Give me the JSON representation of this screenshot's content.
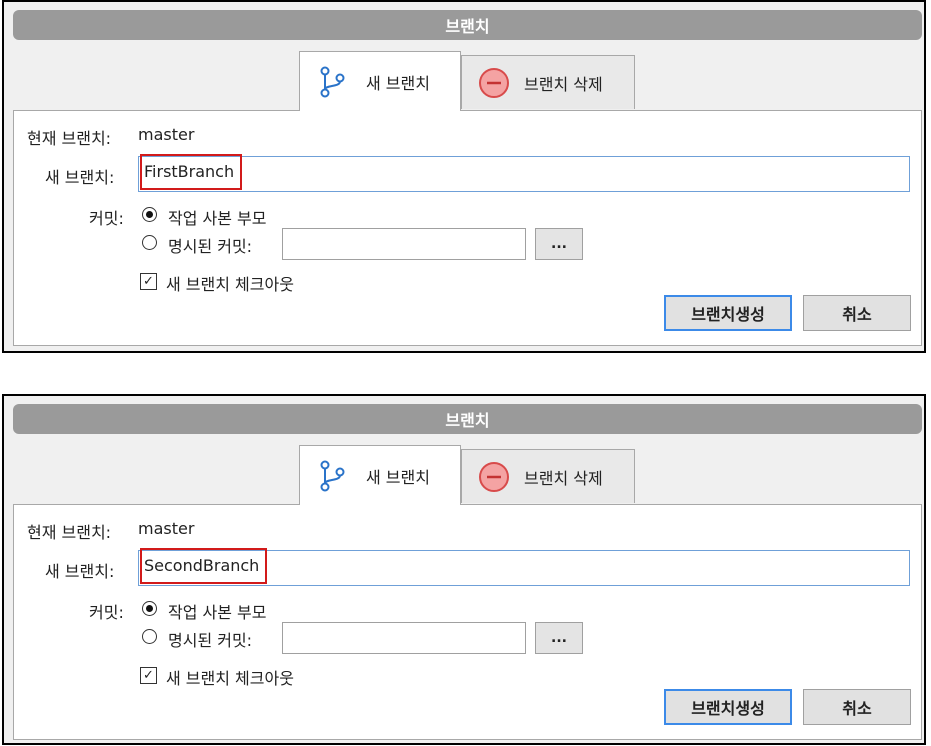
{
  "dialogs": [
    {
      "title": "브랜치",
      "tabs": [
        {
          "label": "새 브랜치",
          "icon": "branch-icon"
        },
        {
          "label": "브랜치 삭제",
          "icon": "minus-circle-icon"
        }
      ],
      "current_branch_label": "현재 브랜치:",
      "current_branch_value": "master",
      "new_branch_label": "새 브랜치:",
      "new_branch_value": "FirstBranch",
      "commit_label": "커밋:",
      "commit_options": [
        {
          "label": "작업 사본 부모",
          "checked": true
        },
        {
          "label": "명시된 커밋:",
          "checked": false
        }
      ],
      "commit_input_value": "",
      "browse_label": "...",
      "checkout_label": "새 브랜치 체크아웃",
      "checkout_checked": true,
      "create_button": "브랜치생성",
      "cancel_button": "취소"
    },
    {
      "title": "브랜치",
      "tabs": [
        {
          "label": "새 브랜치",
          "icon": "branch-icon"
        },
        {
          "label": "브랜치 삭제",
          "icon": "minus-circle-icon"
        }
      ],
      "current_branch_label": "현재 브랜치:",
      "current_branch_value": "master",
      "new_branch_label": "새 브랜치:",
      "new_branch_value": "SecondBranch",
      "commit_label": "커밋:",
      "commit_options": [
        {
          "label": "작업 사본 부모",
          "checked": true
        },
        {
          "label": "명시된 커밋:",
          "checked": false
        }
      ],
      "commit_input_value": "",
      "browse_label": "...",
      "checkout_label": "새 브랜치 체크아웃",
      "checkout_checked": true,
      "create_button": "브랜치생성",
      "cancel_button": "취소"
    }
  ],
  "colors": {
    "title_bar": "#9a9a9a",
    "highlight_border": "#d21a1a",
    "focus_border": "#3c8ae8",
    "branch_icon": "#2a73c9",
    "delete_icon_fill": "#f4a3a3",
    "delete_icon_stroke": "#d84b4b"
  }
}
